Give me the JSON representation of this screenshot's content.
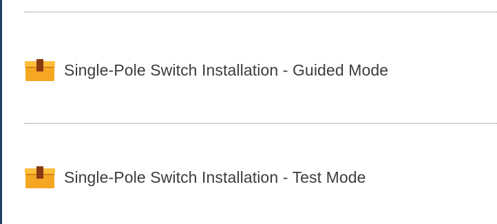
{
  "list": {
    "items": [
      {
        "label": "Single-Pole Switch Installation - Guided Mode",
        "icon": "package-icon"
      },
      {
        "label": "Single-Pole Switch Installation - Test Mode",
        "icon": "package-icon"
      }
    ]
  },
  "colors": {
    "frame_border": "#1f3e63",
    "icon_box": "#f5a623",
    "icon_box_dark": "#d98612",
    "icon_tape": "#8a3a12",
    "text": "#3c3c3c",
    "divider": "#6b6b6b"
  }
}
